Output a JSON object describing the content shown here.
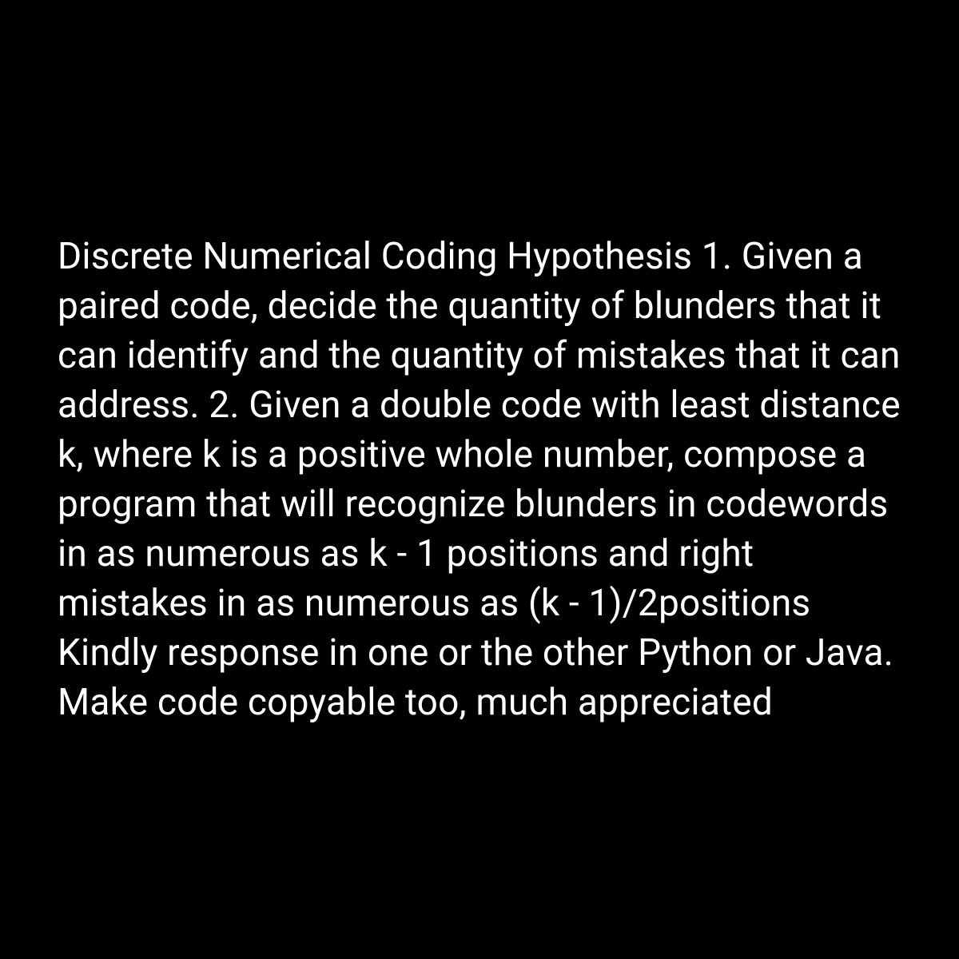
{
  "document": {
    "text": "Discrete Numerical Coding Hypothesis 1. Given a paired code, decide the quantity of blunders that it can identify and the quantity of mistakes that it can address. 2. Given a double code with least distance k, where k is a positive whole number, compose a program that will recognize blunders in codewords in as numerous as k - 1 positions and right mistakes in as numerous as (k - 1)/2positions Kindly response in one or the other Python or Java. Make code copyable too, much appreciated"
  }
}
